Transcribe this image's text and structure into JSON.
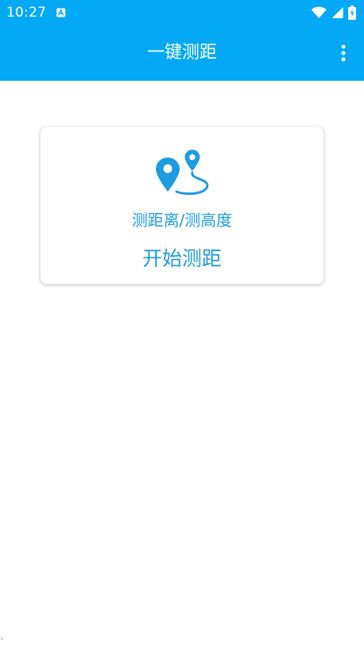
{
  "status_bar": {
    "time": "10:27",
    "notification_icon": "text-a-icon",
    "wifi_icon": "wifi-icon",
    "signal_icon": "cell-signal-icon",
    "battery_icon": "battery-charging-icon"
  },
  "app_bar": {
    "title": "一键测距",
    "menu_icon": "more-vert-icon"
  },
  "card": {
    "icon": "route-location-pins-icon",
    "subtitle": "测距离/测高度",
    "action_label": "开始测距"
  },
  "colors": {
    "primary": "#03A9F4",
    "accent_text": "#1E9BE0",
    "background": "#FFFFFF"
  }
}
